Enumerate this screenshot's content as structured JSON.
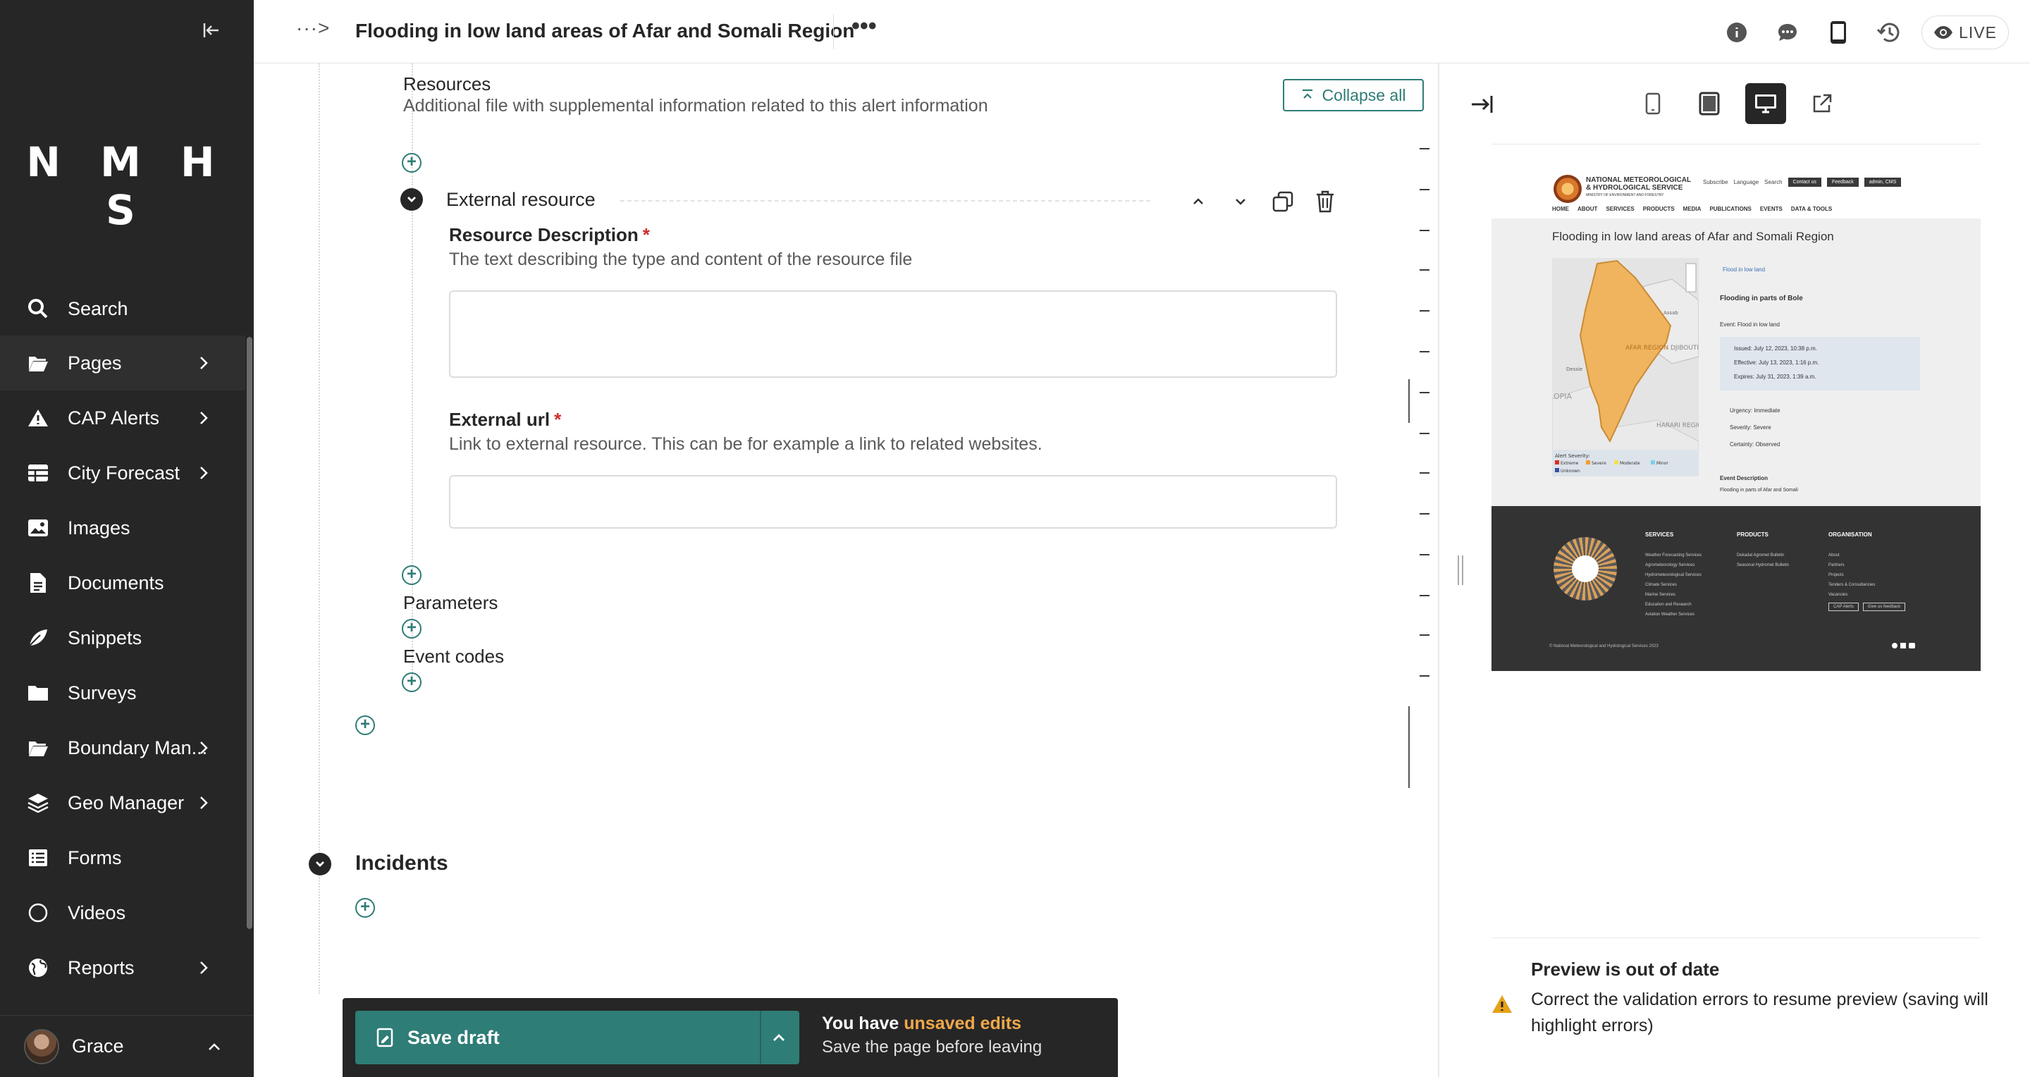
{
  "sidebar": {
    "logo": "N M H S",
    "search_label": "Search",
    "items": [
      {
        "label": "Pages",
        "icon": "folder-open-icon",
        "has_submenu": true
      },
      {
        "label": "CAP Alerts",
        "icon": "warning-icon",
        "has_submenu": true
      },
      {
        "label": "City Forecast",
        "icon": "table-icon",
        "has_submenu": true
      },
      {
        "label": "Images",
        "icon": "image-icon",
        "has_submenu": false
      },
      {
        "label": "Documents",
        "icon": "document-icon",
        "has_submenu": false
      },
      {
        "label": "Snippets",
        "icon": "snippet-icon",
        "has_submenu": false
      },
      {
        "label": "Surveys",
        "icon": "folder-icon",
        "has_submenu": false
      },
      {
        "label": "Boundary Man...",
        "icon": "folder-open-icon",
        "has_submenu": true
      },
      {
        "label": "Geo Manager",
        "icon": "layers-icon",
        "has_submenu": true
      },
      {
        "label": "Forms",
        "icon": "list-icon",
        "has_submenu": false
      },
      {
        "label": "Videos",
        "icon": "circle-icon",
        "has_submenu": false
      },
      {
        "label": "Reports",
        "icon": "globe-icon",
        "has_submenu": true
      }
    ],
    "user": {
      "name": "Grace"
    }
  },
  "header": {
    "breadcrumb_more": "···>",
    "title": "Flooding in low land areas of Afar and Somali Region",
    "more_actions": "•••",
    "live_label": "LIVE"
  },
  "form": {
    "resources": {
      "title": "Resources",
      "help": "Additional file with supplemental information related to this alert information",
      "collapse_all": "Collapse all"
    },
    "external_resource": {
      "title": "External resource",
      "description_label": "Resource Description",
      "description_help": "The text describing the type and content of the resource file",
      "description_value": "",
      "url_label": "External url",
      "url_help": "Link to external resource. This can be for example a link to related websites.",
      "url_value": "",
      "required_mark": "*"
    },
    "parameters_title": "Parameters",
    "event_codes_title": "Event codes",
    "incidents_title": "Incidents"
  },
  "savebar": {
    "save_label": "Save draft",
    "msg_prefix": "You have ",
    "msg_emphasis": "unsaved edits",
    "msg_line2": "Save the page before leaving"
  },
  "preview": {
    "site": {
      "org_line1": "NATIONAL METEOROLOGICAL",
      "org_line2": "& HYDROLOGICAL SERVICE",
      "org_line3": "MINISTRY OF ENVIRONMENT AND FORESTRY",
      "util_subscribe": "Subscribe",
      "util_language": "Language",
      "util_search": "Search",
      "util_contact": "Contact us",
      "util_feedback": "Feedback",
      "util_admin": "admin, CMS",
      "nav": [
        "HOME",
        "ABOUT",
        "SERVICES",
        "PRODUCTS",
        "MEDIA",
        "PUBLICATIONS",
        "EVENTS",
        "DATA & TOOLS"
      ],
      "page_title": "Flooding in low land areas of Afar and Somali Region",
      "tag": "Flood in low land",
      "card_title": "Flooding in parts of Bole",
      "event_line": "Event:   Flood in low land",
      "issued": "Issued: July 12, 2023, 10:38 p.m.",
      "effective": "Effective: July 13, 2023, 1:16 p.m.",
      "expires": "Expires: July 31, 2023, 1:39 a.m.",
      "urgency": "Urgency: Immediate",
      "severity": "Severity: Severe",
      "certainty": "Certainty: Observed",
      "event_desc_title": "Event Description",
      "event_desc": "Flooding in parts of Afar and Somali",
      "map_labels": [
        "AFAR REGION",
        "DJIBOUTI",
        "HARARI REGION",
        "OPIA",
        "Assab",
        "Dessie"
      ],
      "legend_title": "Alert Severity:",
      "legend": [
        "Extreme",
        "Severe",
        "Moderate",
        "Minor",
        "Unknown"
      ],
      "footer_services": [
        "SERVICES",
        "Weather Forecasting Services",
        "Agrometeorology Services",
        "Hydrometeorological Services",
        "Climate Services",
        "Marine Services",
        "Education and Research",
        "Aviation Weather Services"
      ],
      "footer_products": [
        "PRODUCTS",
        "Dekadal Agromet Bulletin",
        "Seasonal Hydromet Bulletin"
      ],
      "footer_org": [
        "ORGANISATION",
        "About",
        "Partners",
        "Projects",
        "Tenders & Consultancies",
        "Vacancies"
      ],
      "footer_buttons": [
        "CAP Alerts",
        "Give us feedback"
      ],
      "copyright": "© National Meteorological and Hydrological Services 2023"
    },
    "warning_title": "Preview is out of date",
    "warning_text": "Correct the validation errors to resume preview (saving will highlight errors)"
  },
  "colors": {
    "sidebar_bg": "#262626",
    "teal": "#2e7d76",
    "required": "#cd2e2e",
    "unsaved": "#f1a84b",
    "warning": "#e6a117"
  }
}
